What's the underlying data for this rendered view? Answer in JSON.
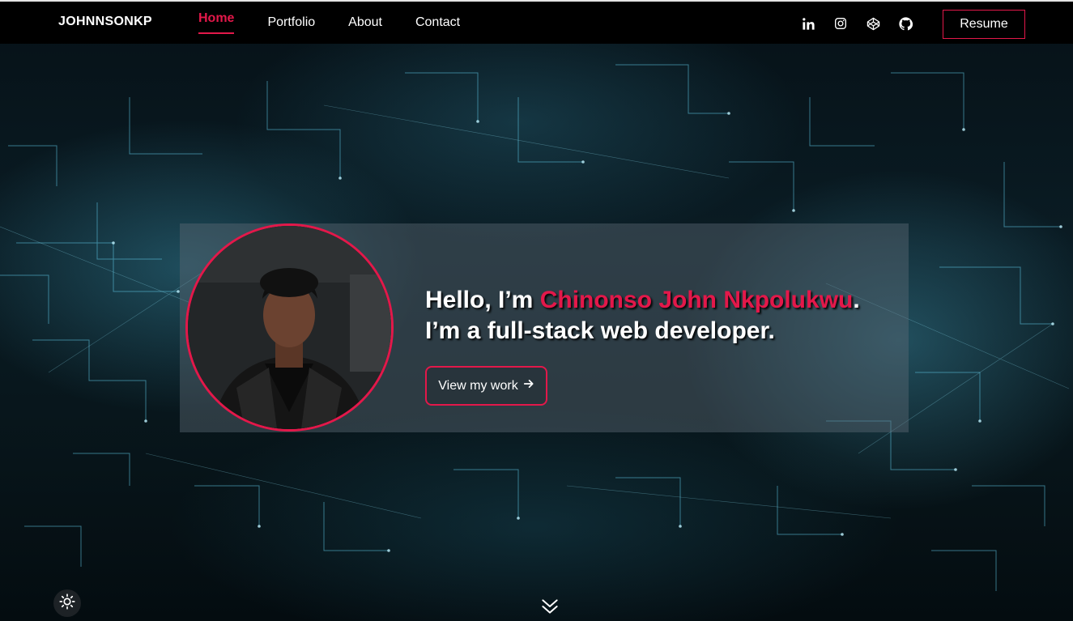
{
  "header": {
    "brand": "JOHNNSONKP",
    "nav": [
      {
        "label": "Home",
        "active": true
      },
      {
        "label": "Portfolio",
        "active": false
      },
      {
        "label": "About",
        "active": false
      },
      {
        "label": "Contact",
        "active": false
      }
    ],
    "socials": [
      "linkedin-icon",
      "instagram-icon",
      "codepen-icon",
      "github-icon"
    ],
    "resume_label": "Resume"
  },
  "hero": {
    "greeting": "Hello, I’m ",
    "name": "Chinonso John Nkpolukwu",
    "period": ".",
    "subline": "I’m a full-stack web developer.",
    "cta_label": "View my work",
    "cta_icon": "arrow-right-icon"
  },
  "controls": {
    "theme_icon": "sun-icon",
    "scroll_icon": "chevron-double-down-icon"
  },
  "colors": {
    "accent": "#e3184a",
    "header_bg": "#000000",
    "network_glow": "#5fd0ee"
  }
}
